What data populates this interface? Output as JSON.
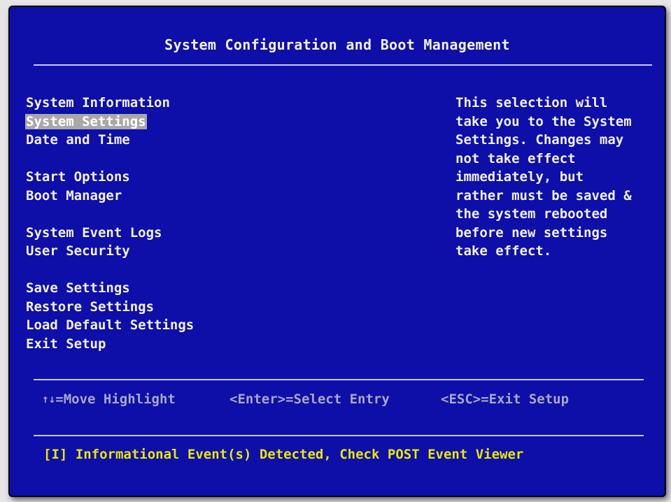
{
  "title": "System Configuration and Boot Management",
  "menu": {
    "groups": [
      [
        {
          "label": "System Information",
          "selected": false
        },
        {
          "label": "System Settings",
          "selected": true
        },
        {
          "label": "Date and Time",
          "selected": false
        }
      ],
      [
        {
          "label": "Start Options",
          "selected": false
        },
        {
          "label": "Boot Manager",
          "selected": false
        }
      ],
      [
        {
          "label": "System Event Logs",
          "selected": false
        },
        {
          "label": "User Security",
          "selected": false
        }
      ],
      [
        {
          "label": "Save Settings",
          "selected": false
        },
        {
          "label": "Restore Settings",
          "selected": false
        },
        {
          "label": "Load Default Settings",
          "selected": false
        },
        {
          "label": "Exit Setup",
          "selected": false
        }
      ]
    ]
  },
  "help": {
    "lines": [
      "This selection will",
      "take you to the System",
      "Settings. Changes may",
      "not take effect",
      "immediately, but",
      "rather must be saved &",
      "the system rebooted",
      "before new settings",
      "take effect."
    ]
  },
  "hints": {
    "move_icon": "up-down-arrows-icon",
    "move_glyph": "↑↓",
    "move_label": "=Move Highlight",
    "enter_label": "<Enter>=Select Entry",
    "esc_label": "<ESC>=Exit Setup"
  },
  "status": {
    "message": "[I] Informational Event(s) Detected, Check POST Event Viewer"
  },
  "colors": {
    "background": "#0e0ea8",
    "text": "#f2f2f2",
    "highlight": "#a8a8a8",
    "hint_text": "#a8a8c8",
    "status_text": "#e8e800"
  }
}
